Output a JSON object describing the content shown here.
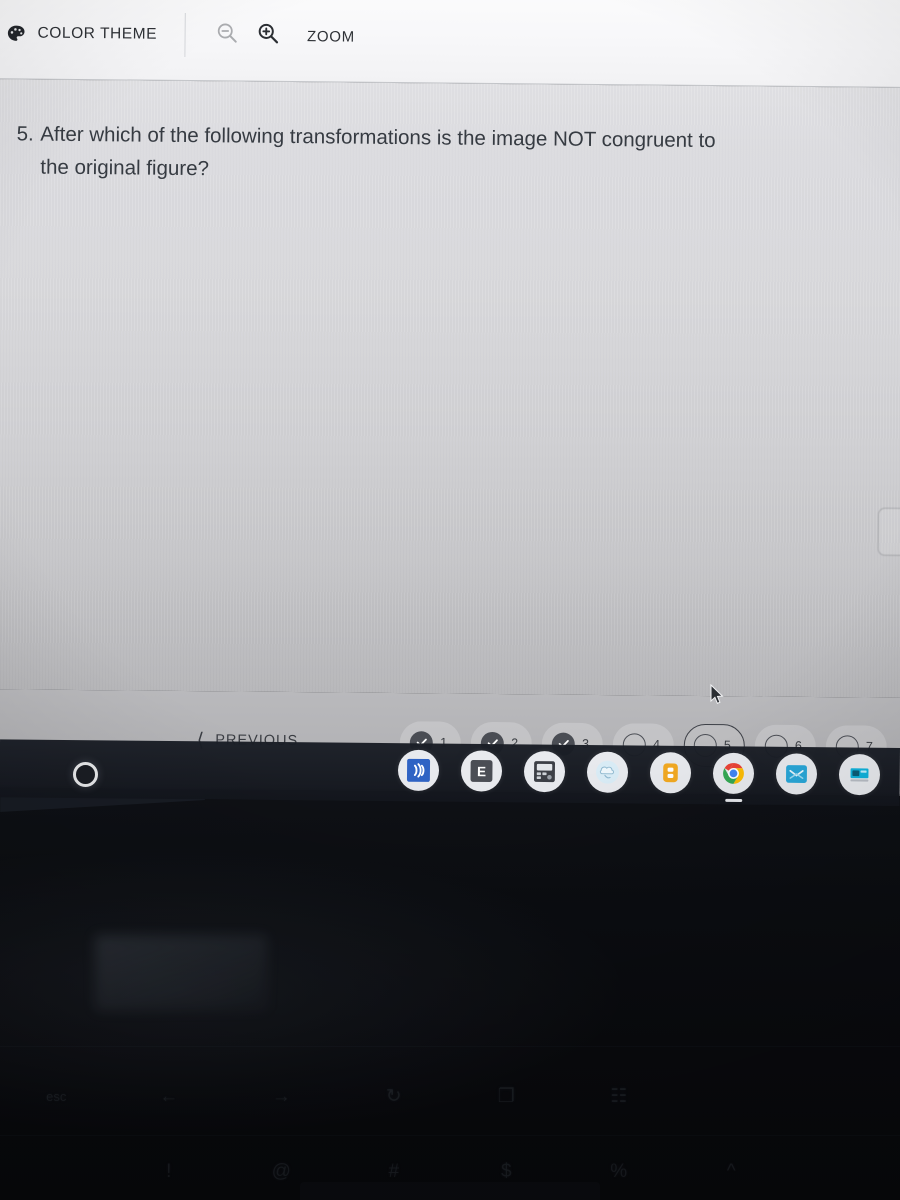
{
  "header": {
    "palette_icon": "palette-icon",
    "color_theme_label": "COLOR THEME",
    "zoom_out_icon": "magnifier-minus-icon",
    "zoom_in_icon": "magnifier-plus-icon",
    "zoom_label": "ZOOM"
  },
  "question": {
    "number": "5.",
    "line1": "After which of the following transformations is the image NOT congruent to",
    "line2": "the original figure?"
  },
  "pager": {
    "previous_label": "PREVIOUS",
    "previous_icon": "chevron-left-icon",
    "items": [
      {
        "num": "1",
        "state": "done"
      },
      {
        "num": "2",
        "state": "done"
      },
      {
        "num": "3",
        "state": "done"
      },
      {
        "num": "4",
        "state": "todo"
      },
      {
        "num": "5",
        "state": "current"
      },
      {
        "num": "6",
        "state": "todo"
      },
      {
        "num": "7",
        "state": "todo"
      }
    ]
  },
  "shelf": {
    "launcher_icon": "launcher-circle-icon",
    "icons": [
      {
        "name": "sound-waves-icon",
        "label": ""
      },
      {
        "name": "letter-e-app-icon",
        "label": "E"
      },
      {
        "name": "calculator-device-icon",
        "label": ""
      },
      {
        "name": "cloud-app-icon",
        "label": ""
      },
      {
        "name": "drive-app-icon",
        "label": ""
      },
      {
        "name": "chrome-browser-icon",
        "label": "",
        "active": true
      },
      {
        "name": "blue-app-icon",
        "label": ""
      },
      {
        "name": "teal-app-icon",
        "label": ""
      }
    ]
  },
  "keyboard": {
    "fn_row": [
      "esc",
      "←",
      "→",
      "↻",
      "❐",
      "☷",
      "",
      ""
    ],
    "num_row": [
      "",
      "!",
      "@",
      "#",
      "$",
      "%",
      "^",
      ""
    ]
  },
  "colors": {
    "accent_dark": "#4a4d54",
    "content_bg": "#dadadd",
    "header_bg": "#f7f7f9",
    "pager_bg": "#b4b4b7",
    "shelf_bg": "#161a21"
  }
}
